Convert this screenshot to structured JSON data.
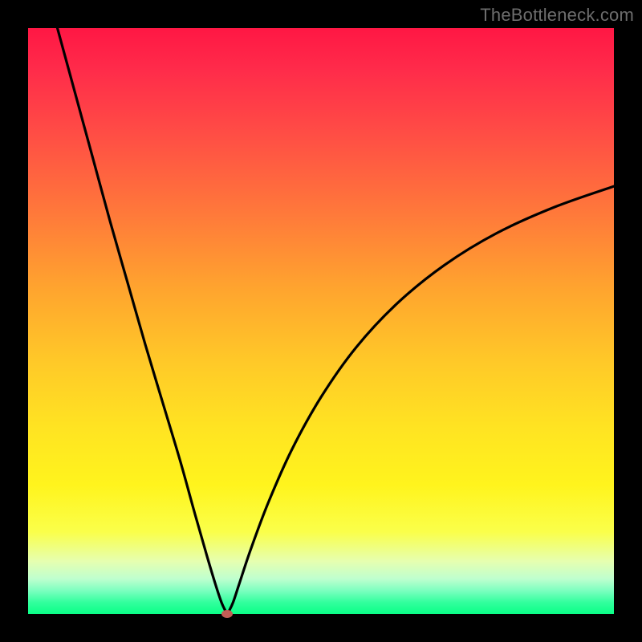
{
  "attribution": "TheBottleneck.com",
  "colors": {
    "frame": "#000000",
    "attribution_text": "#6d6d6d",
    "curve_stroke": "#000000",
    "dot_fill": "#c25d55",
    "gradient_stops": [
      "#ff1744",
      "#ff2b4a",
      "#ff4d45",
      "#ff7a3a",
      "#ffa62e",
      "#ffc928",
      "#ffe322",
      "#fff41d",
      "#faff4a",
      "#e6ffb0",
      "#bfffcf",
      "#7dffc0",
      "#33ff9e",
      "#0aff87"
    ]
  },
  "chart_data": {
    "type": "line",
    "title": "",
    "xlabel": "",
    "ylabel": "",
    "xlim": [
      0,
      100
    ],
    "ylim": [
      0,
      100
    ],
    "grid": false,
    "legend": false,
    "series": [
      {
        "name": "bottleneck-curve",
        "x": [
          5,
          8,
          11,
          14,
          17,
          20,
          23,
          26,
          28.5,
          30.5,
          32,
          33,
          33.7,
          34,
          34.3,
          35,
          36,
          38,
          41,
          45,
          50,
          56,
          63,
          71,
          80,
          90,
          100
        ],
        "y": [
          100,
          89,
          78,
          67,
          56.5,
          46,
          36,
          26,
          17,
          10,
          5,
          2,
          0.5,
          0,
          0.5,
          2,
          5,
          11,
          19,
          28,
          37,
          45.5,
          53,
          59.5,
          65,
          69.5,
          73
        ]
      }
    ],
    "marker": {
      "name": "optimal-point",
      "x": 34,
      "y": 0
    }
  }
}
